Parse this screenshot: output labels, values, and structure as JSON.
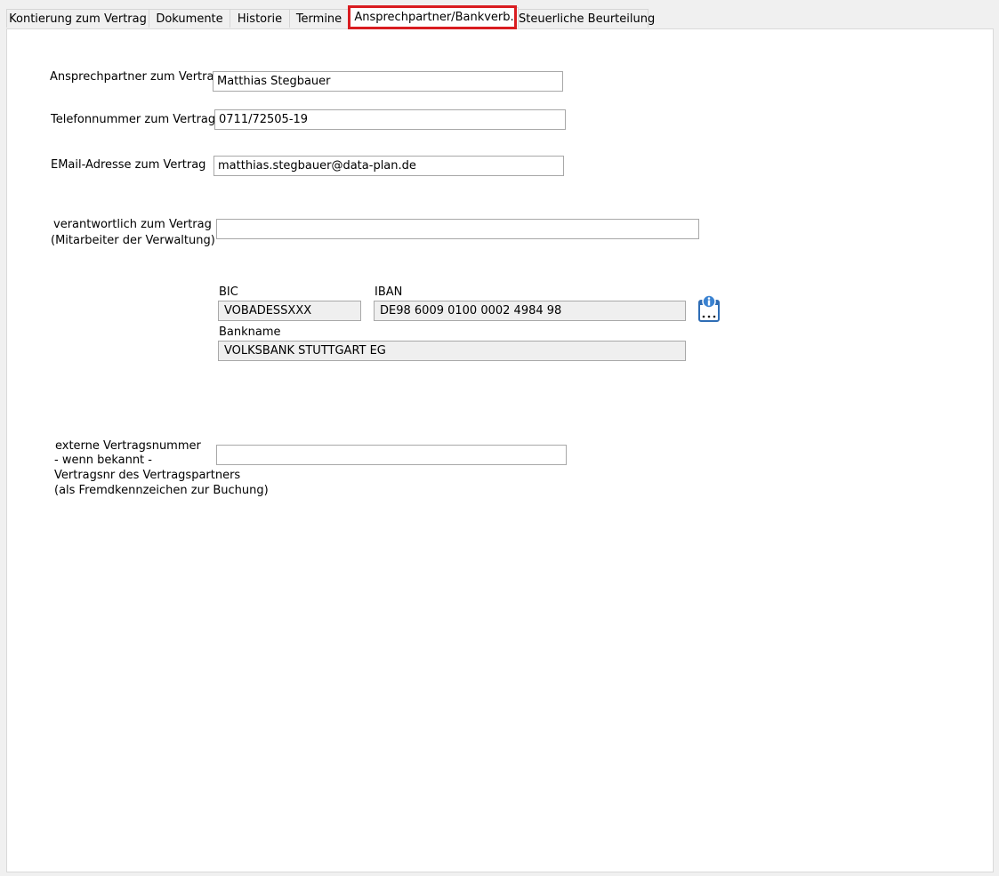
{
  "tabs": [
    {
      "label": "Kontierung zum Vertrag"
    },
    {
      "label": "Dokumente"
    },
    {
      "label": "Historie"
    },
    {
      "label": "Termine"
    },
    {
      "label": "Ansprechpartner/Bankverb.",
      "active": true
    },
    {
      "label": "Steuerliche Beurteilung"
    }
  ],
  "form": {
    "contact_label": "Ansprechpartner zum Vertrag",
    "contact_value": "Matthias Stegbauer",
    "phone_label": "Telefonnummer zum Vertrag",
    "phone_value": "0711/72505-19",
    "email_label": "EMail-Adresse zum Vertrag",
    "email_value": "matthias.stegbauer@data-plan.de",
    "responsible_label_1": "verantwortlich zum Vertrag",
    "responsible_label_2": "(Mitarbeiter der Verwaltung)",
    "responsible_value": "",
    "external_label_1": "externe Vertragsnummer",
    "external_label_2": "- wenn bekannt -",
    "external_label_3": "Vertragsnr des Vertragspartners",
    "external_label_4": "(als Fremdkennzeichen zur Buchung)",
    "external_value": ""
  },
  "bank": {
    "bic_label": "BIC",
    "bic_value": "VOBADESSXXX",
    "iban_label": "IBAN",
    "iban_value": "DE98 6009 0100 0002 4984 98",
    "bankname_label": "Bankname",
    "bankname_value": "VOLKSBANK STUTTGART EG",
    "info_icon": "bank-info-icon"
  },
  "colors": {
    "highlight": "#d91c20",
    "readonly_bg": "#efefef",
    "icon_blue": "#2f6db5"
  }
}
